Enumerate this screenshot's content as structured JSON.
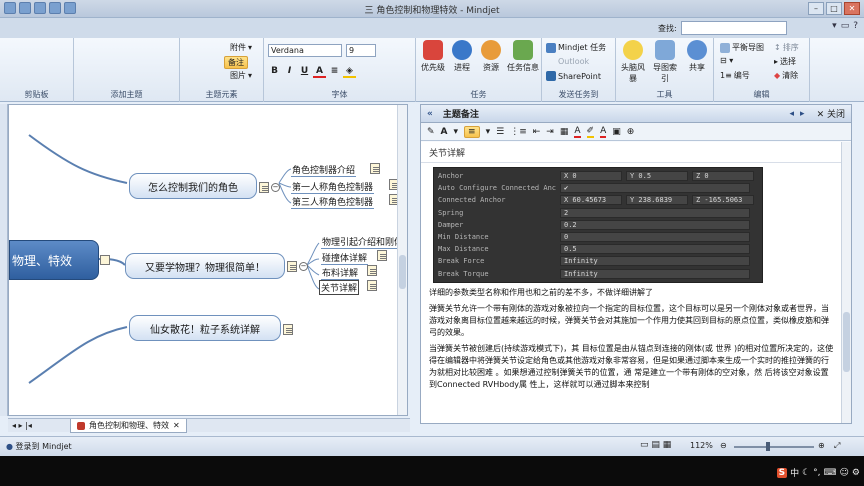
{
  "window": {
    "title": "三  角色控制和物理特效 - Mindjet"
  },
  "ribbon": {
    "search_label": "查找:",
    "search_value": "",
    "groups": {
      "clipboard": "剪贴板",
      "add_topic": "添加主题",
      "topic_elements": "主题元素",
      "font": "字体",
      "tasks": "任务",
      "send_tasks": "发送任务到",
      "tools": "工具",
      "edit": "编辑"
    },
    "topic_elements": {
      "attachment": "附件",
      "notes": "备注",
      "image": "图片"
    },
    "font": {
      "family": "Verdana",
      "size": "9",
      "bold": "B",
      "italic": "I",
      "underline": "U"
    },
    "tasks": {
      "priority": "优先级",
      "progress": "进程",
      "resources": "资源",
      "task_info": "任务信息"
    },
    "send_tasks": {
      "mindjet_tasks": "Mindjet 任务",
      "outlook": "Outlook",
      "sharepoint": "SharePoint"
    },
    "tools": {
      "brainstorm": "头脑风暴",
      "map_index": "导图索引",
      "share": "共享"
    },
    "edit": {
      "balance_map": "平衡导图",
      "sort": "排序",
      "select": "选择",
      "number": "编号",
      "clear": "清除"
    }
  },
  "map": {
    "central": "物理、特效",
    "topics": [
      {
        "label": "怎么控制我们的角色",
        "subs": [
          "角色控制器介绍",
          "第一人称角色控制器",
          "第三人称角色控制器"
        ]
      },
      {
        "label": "又要学物理？物理很简单！",
        "subs": [
          "物理引起介绍和刚体",
          "碰撞体详解",
          "布料详解",
          "关节详解"
        ]
      },
      {
        "label": "仙女散花！粒子系统详解",
        "subs": []
      }
    ]
  },
  "doc_tab": {
    "label": "角色控制和物理、特效"
  },
  "status": {
    "login": "登录到 Mindjet",
    "zoom": "112%"
  },
  "notes_panel": {
    "title": "主题备注",
    "close_label": "关闭",
    "section_title": "关节详解",
    "inspector": [
      {
        "label": "Anchor",
        "values": [
          "X 0",
          "Y 0.5",
          "Z 0"
        ]
      },
      {
        "label": "Auto Configure Connected Anc",
        "values": [
          "✔"
        ]
      },
      {
        "label": "Connected Anchor",
        "values": [
          "X 60.45673",
          "Y 238.6839",
          "Z -165.5063"
        ]
      },
      {
        "label": "Spring",
        "values": [
          "2"
        ]
      },
      {
        "label": "Damper",
        "values": [
          "0.2"
        ]
      },
      {
        "label": "Min Distance",
        "values": [
          "0"
        ]
      },
      {
        "label": "Max Distance",
        "values": [
          "0.5"
        ]
      },
      {
        "label": "Break Force",
        "values": [
          "Infinity"
        ]
      },
      {
        "label": "Break Torque",
        "values": [
          "Infinity"
        ]
      }
    ],
    "paragraphs": [
      "详细的参数类型名称和作用也和之前的差不多，不做详细讲解了",
      "弹簧关节允许一个带有刚体的游戏对象被拉向一个指定的目标位置，这个目标可以是另一个刚体对象或者世界，当游戏对象离目标位置越来越远的时候，弹簧关节会对其施加一个作用力使其回到目标的原点位置，类似橡皮筋和弹弓的效果。",
      "当弹簧关节被创建后(持续游戏模式下)，其 目标位置是由从锚点到连接的刚体(或 世界 )的相对位置所决定的，这使得在编辑器中将弹簧关节设定给角色或其他游戏对象非常容易，但是如果通过脚本来生成一个实时的推拉弹簧的行为就相对比较困难 。如果想通过控制弹簧关节的位置，通 常是建立一个带有刚体的空对象，然 后将该空对象设置到Connected RVHbody属 性上，这样就可以通过脚本来控制"
    ]
  },
  "tray": {
    "ime": "S",
    "lang": "中"
  },
  "colors": {
    "central": "#3b6aa9",
    "topic_border": "#6f91bd",
    "inspector_bg": "#333333",
    "highlight": "#f7c24d"
  }
}
